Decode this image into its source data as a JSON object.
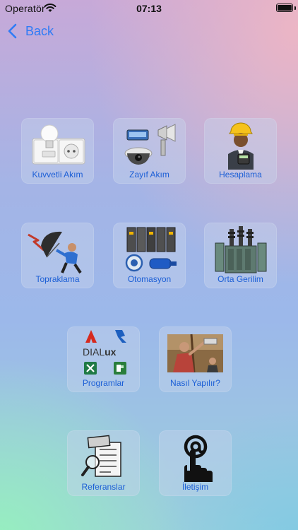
{
  "status_bar": {
    "carrier": "Operatör",
    "time": "07:13"
  },
  "nav": {
    "back_label": "Back"
  },
  "menu": {
    "kuvvetli_akim": "Kuvvetli Akım",
    "zayif_akim": "Zayıf Akım",
    "hesaplama": "Hesaplama",
    "topraklama": "Topraklama",
    "otomasyon": "Otomasyon",
    "orta_gerilim": "Orta Gerilim",
    "programlar": "Programlar",
    "nasil_yapilir": "Nasıl Yapılır?",
    "referanslar": "Referanslar",
    "iletisim": "İletişim"
  },
  "programlar_logos": {
    "dialux_prefix": "DIAL",
    "dialux_suffix": "ux"
  },
  "colors": {
    "accent": "#2f7bf6",
    "tile_label": "#1c5fd6"
  }
}
